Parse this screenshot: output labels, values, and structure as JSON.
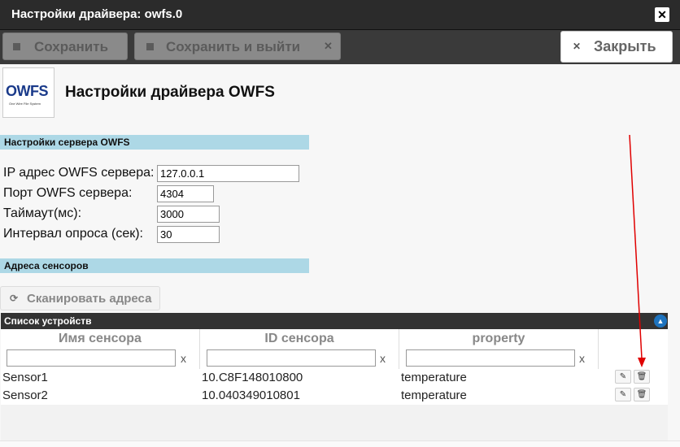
{
  "window": {
    "title": "Настройки драйвера: owfs.0",
    "close_icon": "close-icon"
  },
  "toolbar": {
    "save_label": "Сохранить",
    "save_exit_label": "Сохранить и выйти",
    "close_label": "Закрыть"
  },
  "logo": {
    "text": "OWFS",
    "subtitle": "One Wire File System"
  },
  "page": {
    "heading": "Настройки драйвера OWFS"
  },
  "sections": {
    "server": "Настройки сервера OWFS",
    "sensors": "Адреса сенсоров"
  },
  "form": {
    "ip": {
      "label": "IP адрес OWFS сервера:",
      "value": "127.0.0.1"
    },
    "port": {
      "label": "Порт OWFS сервера:",
      "value": "4304"
    },
    "timeout": {
      "label": "Таймаут(мс):",
      "value": "3000"
    },
    "interval": {
      "label": "Интервал опроса (сек):",
      "value": "30"
    }
  },
  "scan": {
    "label": "Сканировать адреса"
  },
  "grid": {
    "title": "Список устройств",
    "columns": [
      "Имя сенсора",
      "ID сенсора",
      "property"
    ],
    "filter_clear": "x",
    "rows": [
      {
        "name": "Sensor1",
        "id": "10.C8F148010800",
        "property": "temperature"
      },
      {
        "name": "Sensor2",
        "id": "10.040349010801",
        "property": "temperature"
      }
    ]
  },
  "colors": {
    "section_bg": "#add8e6",
    "annotation_arrow": "#e00000",
    "collapse_icon": "#1e73be"
  }
}
